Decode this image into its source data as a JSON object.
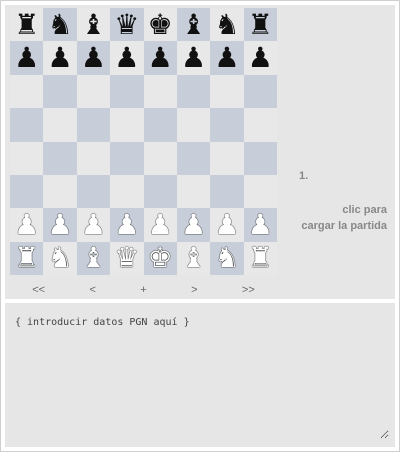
{
  "board": {
    "ranks": [
      [
        "♜",
        "♞",
        "♝",
        "♛",
        "♚",
        "♝",
        "♞",
        "♜"
      ],
      [
        "♟",
        "♟",
        "♟",
        "♟",
        "♟",
        "♟",
        "♟",
        "♟"
      ],
      [
        "",
        "",
        "",
        "",
        "",
        "",
        "",
        ""
      ],
      [
        "",
        "",
        "",
        "",
        "",
        "",
        "",
        ""
      ],
      [
        "",
        "",
        "",
        "",
        "",
        "",
        "",
        ""
      ],
      [
        "",
        "",
        "",
        "",
        "",
        "",
        "",
        ""
      ],
      [
        "♙",
        "♙",
        "♙",
        "♙",
        "♙",
        "♙",
        "♙",
        "♙"
      ],
      [
        "♖",
        "♘",
        "♗",
        "♕",
        "♔",
        "♗",
        "♘",
        "♖"
      ]
    ],
    "light_color": "#e8e8e8",
    "dark_color": "#c7ced9"
  },
  "nav": {
    "first": "<<",
    "prev": "<",
    "flip": "+",
    "next": ">",
    "last": ">>"
  },
  "moves": {
    "number": "1."
  },
  "load_hint": {
    "line1": "clic para",
    "line2": "cargar la partida"
  },
  "pgn": {
    "placeholder": "{ introducir datos PGN aquí }"
  }
}
